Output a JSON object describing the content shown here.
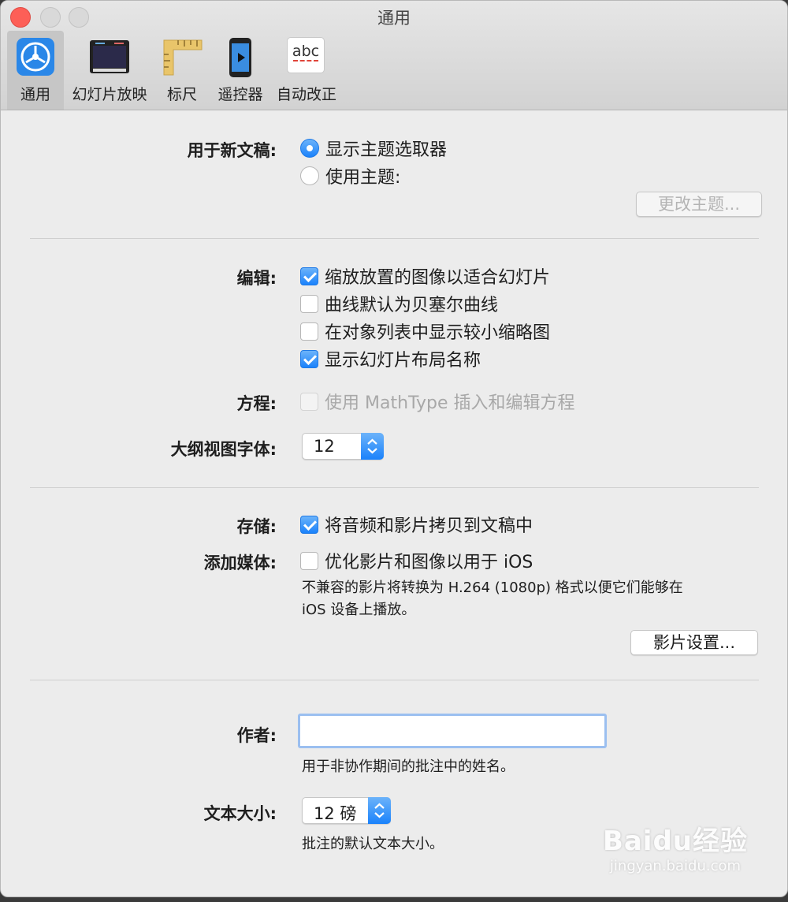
{
  "window": {
    "title": "通用"
  },
  "tabs": [
    {
      "label": "通用",
      "icon": "gear-icon"
    },
    {
      "label": "幻灯片放映",
      "icon": "slideshow-icon"
    },
    {
      "label": "标尺",
      "icon": "ruler-icon"
    },
    {
      "label": "遥控器",
      "icon": "remote-icon"
    },
    {
      "label": "自动改正",
      "icon": "autocorrect-icon"
    }
  ],
  "autocorrect_icon_text": "abc",
  "new_doc": {
    "label": "用于新文稿:",
    "option_show_chooser": "显示主题选取器",
    "option_use_theme": "使用主题:",
    "change_theme_button": "更改主题..."
  },
  "editing": {
    "label": "编辑:",
    "options": [
      {
        "text": "缩放放置的图像以适合幻灯片",
        "checked": true
      },
      {
        "text": "曲线默认为贝塞尔曲线",
        "checked": false
      },
      {
        "text": "在对象列表中显示较小缩略图",
        "checked": false
      },
      {
        "text": "显示幻灯片布局名称",
        "checked": true
      }
    ]
  },
  "equation": {
    "label": "方程:",
    "option": "使用 MathType 插入和编辑方程",
    "enabled": false
  },
  "outline_font": {
    "label": "大纲视图字体:",
    "value": "12"
  },
  "storage": {
    "label": "存储:",
    "option": "将音频和影片拷贝到文稿中",
    "checked": true
  },
  "add_media": {
    "label": "添加媒体:",
    "option": "优化影片和图像以用于 iOS",
    "checked": false,
    "note_line1": "不兼容的影片将转换为 H.264 (1080p) 格式以便它们能够在",
    "note_line2": "iOS 设备上播放。",
    "movie_settings_button": "影片设置..."
  },
  "author": {
    "label": "作者:",
    "value": "",
    "note": "用于非协作期间的批注中的姓名。"
  },
  "text_size": {
    "label": "文本大小:",
    "value": "12 磅",
    "note": "批注的默认文本大小。"
  },
  "watermark": {
    "brand": "Baidu经验",
    "url": "jingyan.baidu.com"
  },
  "colors": {
    "accent": "#1a82fb",
    "close": "#fd5f57",
    "window_bg": "#ececec"
  }
}
